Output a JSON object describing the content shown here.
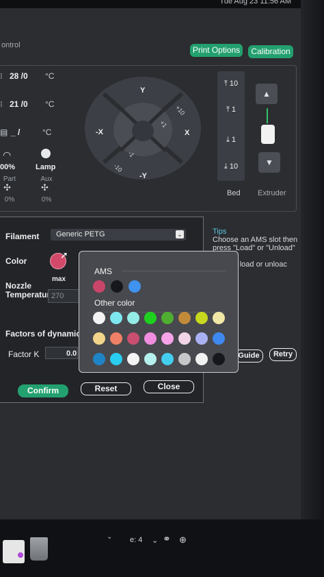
{
  "statusbar": {
    "clock": "Tue Aug 23  11:56 AM"
  },
  "header": {
    "title": "ontrol",
    "print_options": "Print Options",
    "calibration": "Calibration"
  },
  "temps": {
    "nozzle": {
      "value": "28 /0",
      "unit": "°C"
    },
    "bed": {
      "value": "21 /0",
      "unit": "°C"
    },
    "chamber": {
      "value": "_ /",
      "unit": "°C"
    }
  },
  "controls": {
    "part_fan_percent": "00%",
    "lamp": "Lamp",
    "part_label": "Part",
    "aux_label": "Aux",
    "part_value": "0%",
    "aux_value": "0%"
  },
  "jog": {
    "y": "Y",
    "neg_y": "-Y",
    "x": "X",
    "neg_x": "-X",
    "plus10": "+10",
    "plus1": "+1",
    "minus1": "-1",
    "minus10": "-10"
  },
  "bed_axis": {
    "up10": "10",
    "up1": "1",
    "down1": "1",
    "down10": "10",
    "bed_label": "Bed",
    "extruder_label": "Extruder"
  },
  "dialog": {
    "filament_label": "Filament",
    "filament_value": "Generic PETG",
    "color_label": "Color",
    "max_label": "max",
    "nozzle_label_1": "Nozzle",
    "nozzle_label_2": "Temperature",
    "nozzle_value": "270",
    "factors_label": "Factors of dynamic",
    "factor_k_label": "Factor K",
    "factor_k_value": "0.0",
    "confirm": "Confirm",
    "reset": "Reset",
    "close": "Close",
    "selected_color": "#d2496a"
  },
  "tips": {
    "title": "Tips",
    "line1": "Choose an AMS slot then",
    "line2": "press \"Load\" or \"Unload\" to",
    "line3": "...tically load or unloac",
    "line4": "t.",
    "guide": "Guide",
    "retry": "Retry"
  },
  "color_picker": {
    "ams_title": "AMS",
    "other_title": "Other color",
    "ams_colors": [
      "#c9466a",
      "#15171c",
      "#3f92ee"
    ],
    "other_colors": [
      [
        "#f4f4f4",
        "#7ee6ee",
        "#93ece6",
        "#1fd11f",
        "#4fae2f",
        "#c28b3a",
        "#c7d81f",
        "#f1e7a7"
      ],
      [
        "#f2d58a",
        "#f08067",
        "#c94e70",
        "#f08de0",
        "#f6a3e9",
        "#f1d5e7",
        "#a9b1f2",
        "#3e88f0"
      ],
      [
        "#1f84c6",
        "#29cdf0",
        "#f3f3f3",
        "#b5f0ee",
        "#43cdef",
        "#c5c7c9",
        "#f2f2f2",
        "#15171c"
      ]
    ]
  },
  "taskbar": {
    "zoom": "e: 4"
  }
}
